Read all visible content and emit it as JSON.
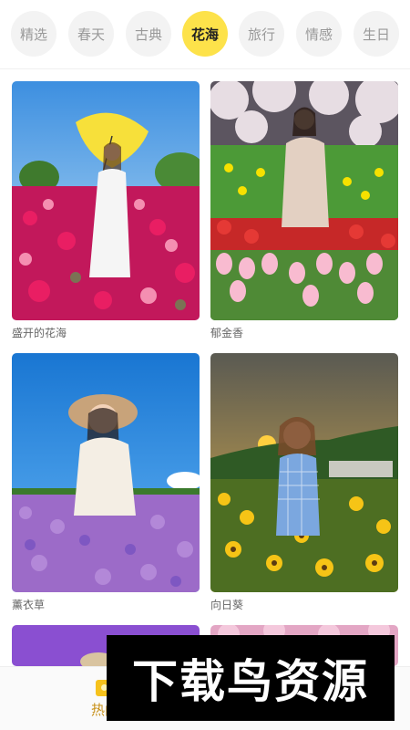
{
  "categories": [
    {
      "label": "精选",
      "active": false
    },
    {
      "label": "春天",
      "active": false
    },
    {
      "label": "古典",
      "active": false
    },
    {
      "label": "花海",
      "active": true
    },
    {
      "label": "旅行",
      "active": false
    },
    {
      "label": "情感",
      "active": false
    },
    {
      "label": "生日",
      "active": false
    }
  ],
  "templates": [
    {
      "title": "盛开的花海"
    },
    {
      "title": "郁金香"
    },
    {
      "title": "薰衣草"
    },
    {
      "title": "向日葵"
    },
    {
      "title": ""
    },
    {
      "title": ""
    }
  ],
  "bottom_nav": {
    "hot_label": "热门"
  },
  "watermark": {
    "text": "下载鸟资源"
  },
  "colors": {
    "accent": "#fde24a",
    "nav_active": "#c8911a"
  }
}
